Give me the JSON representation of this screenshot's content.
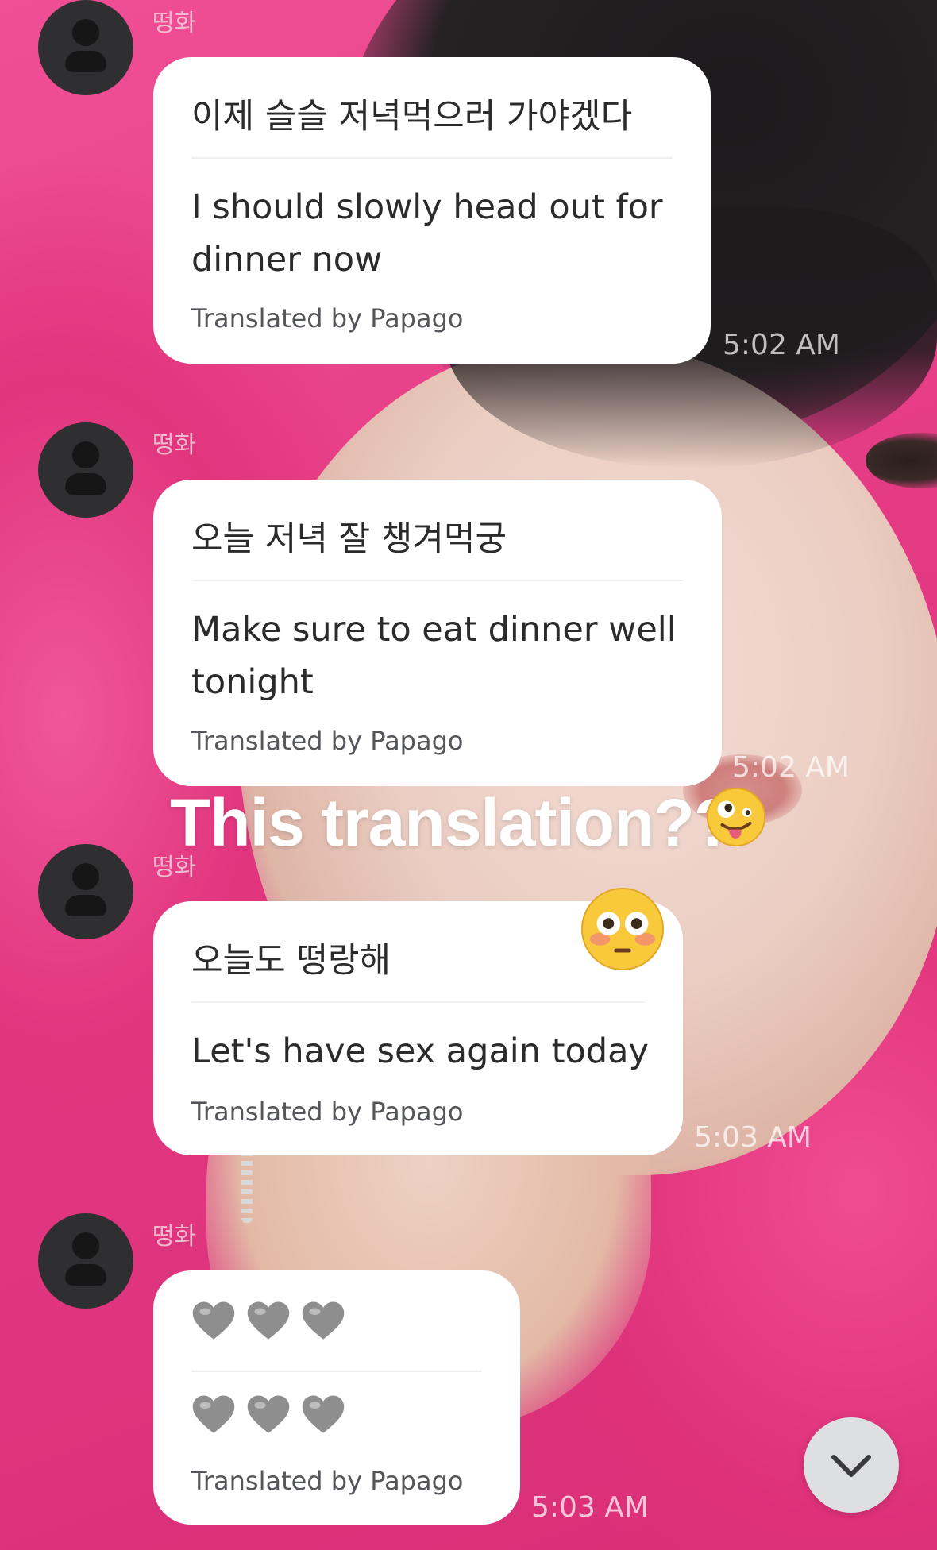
{
  "messages": [
    {
      "sender": "떵화",
      "original": "이제 슬슬 저녁먹으러 가야겠다",
      "translation": "I should slowly head out for dinner now",
      "credit": "Translated by Papago",
      "time": "5:02 AM"
    },
    {
      "sender": "떵화",
      "original": "오늘 저녁 잘 챙겨먹궁",
      "translation": "Make sure to eat dinner well tonight",
      "credit": "Translated by Papago",
      "time": "5:02 AM"
    },
    {
      "sender": "떵화",
      "original": "오늘도 떵랑해",
      "translation": "Let's have sex again today",
      "credit": "Translated by Papago",
      "time": "5:03 AM"
    },
    {
      "sender": "떵화",
      "original_icons": [
        "grey-heart-icon",
        "grey-heart-icon",
        "grey-heart-icon"
      ],
      "translation_icons": [
        "grey-heart-icon",
        "grey-heart-icon",
        "grey-heart-icon"
      ],
      "credit": "Translated by Papago",
      "time": "5:03 AM"
    }
  ],
  "overlay": {
    "caption": "This translation??",
    "caption_emoji": "zany-face-emoji",
    "sticker_emoji": "flushed-face-emoji"
  },
  "controls": {
    "scroll_down_icon": "chevron-down-icon"
  },
  "colors": {
    "bubble": "#ffffff",
    "background_hoodie": "#e53b86",
    "avatar": "#2f2f31",
    "heart_grey": "#8e8e8e"
  }
}
